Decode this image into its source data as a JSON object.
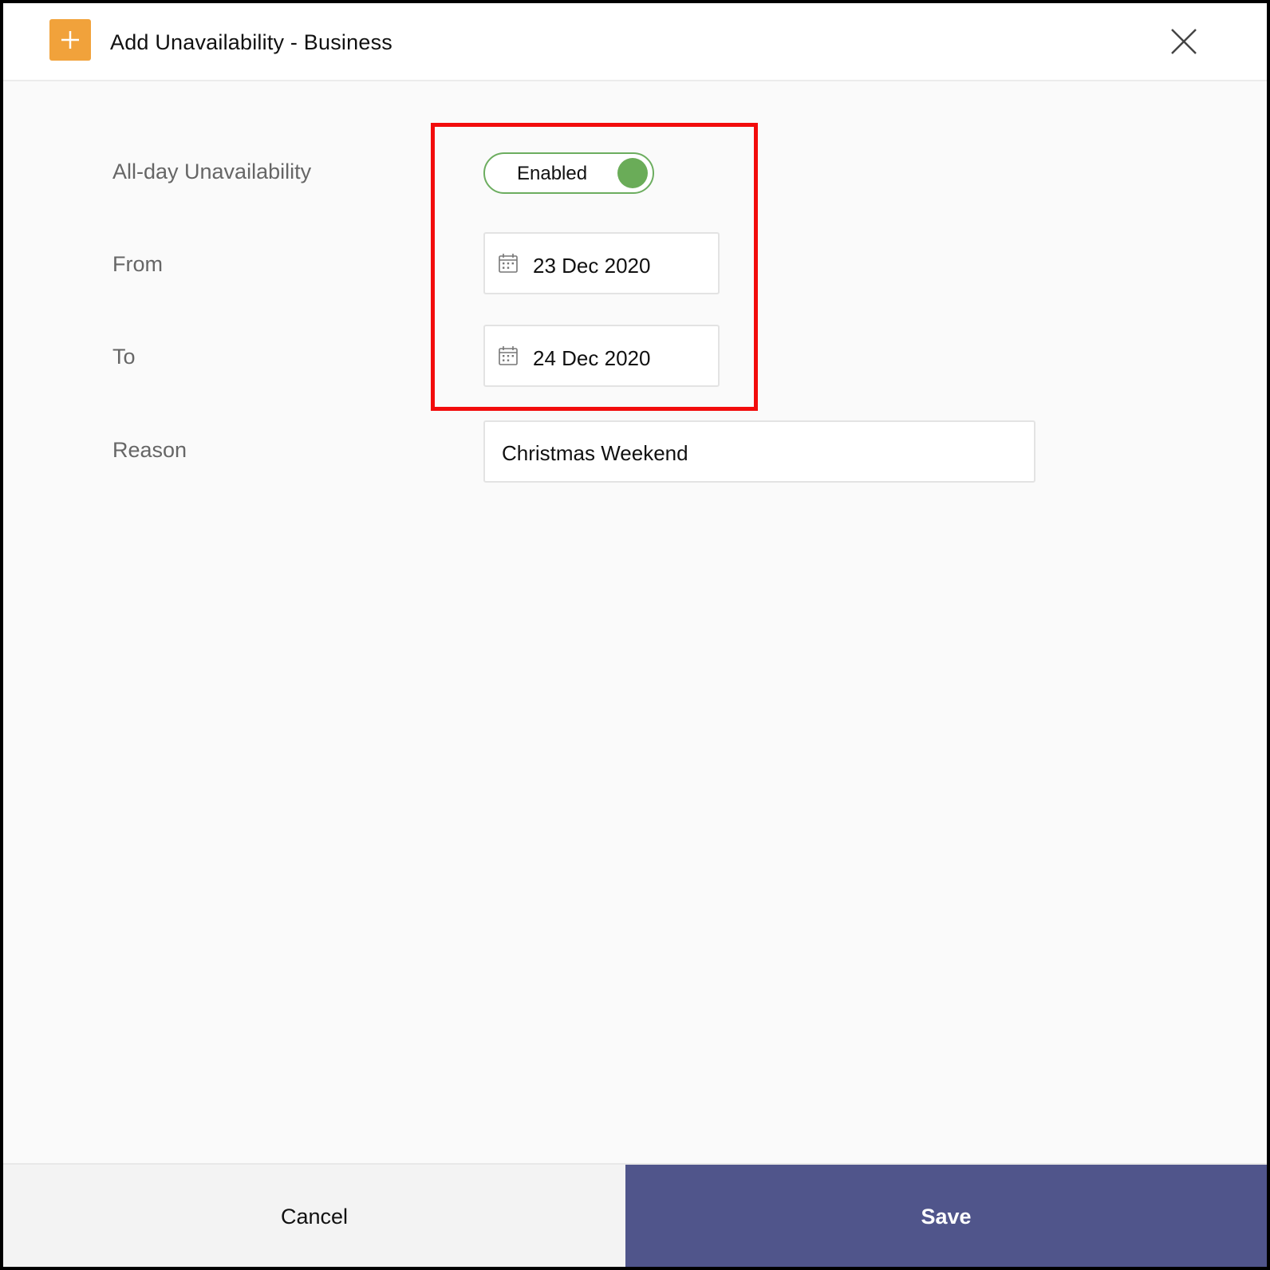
{
  "dialog": {
    "title": "Add Unavailability - Business",
    "header_icon": "plus-icon",
    "close_icon": "close-icon",
    "accent_color": "#f1a23b"
  },
  "form": {
    "all_day": {
      "label": "All-day Unavailability",
      "toggle_text": "Enabled",
      "enabled": true,
      "toggle_color": "#6aac58"
    },
    "from": {
      "label": "From",
      "value": "23 Dec 2020",
      "icon": "calendar-icon"
    },
    "to": {
      "label": "To",
      "value": "24 Dec 2020",
      "icon": "calendar-icon"
    },
    "reason": {
      "label": "Reason",
      "value": "Christmas Weekend"
    }
  },
  "highlight_color": "#f20c0c",
  "footer": {
    "cancel_label": "Cancel",
    "save_label": "Save",
    "save_color": "#50558b"
  }
}
